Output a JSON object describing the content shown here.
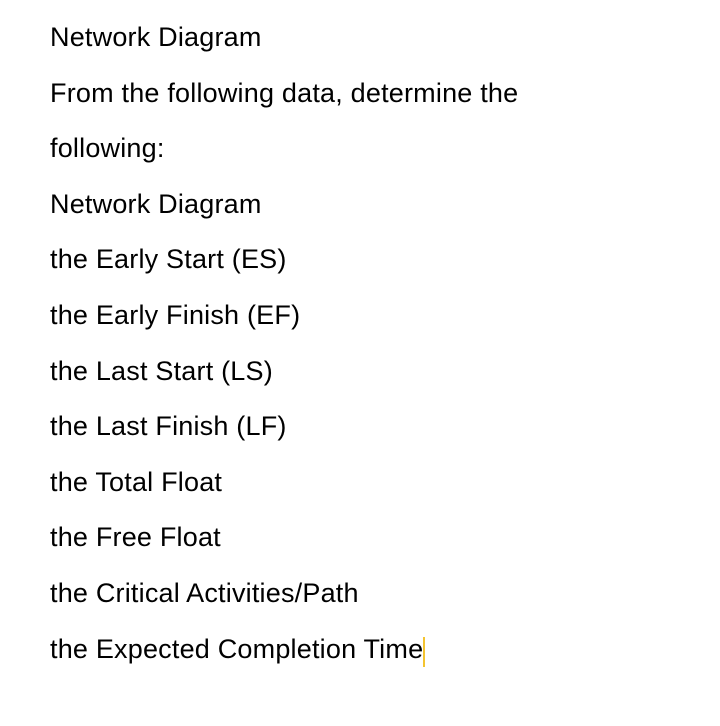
{
  "lines": {
    "l1": "Network Diagram",
    "l2": "From the following data, determine the",
    "l3": "following:",
    "l4": "Network Diagram",
    "l5": "the Early Start (ES)",
    "l6": "the Early Finish (EF)",
    "l7": "the Last Start (LS)",
    "l8": "the Last Finish (LF)",
    "l9": "the Total Float",
    "l10": "the Free Float",
    "l11": "the Critical Activities/Path",
    "l12": "the Expected Completion Time"
  }
}
